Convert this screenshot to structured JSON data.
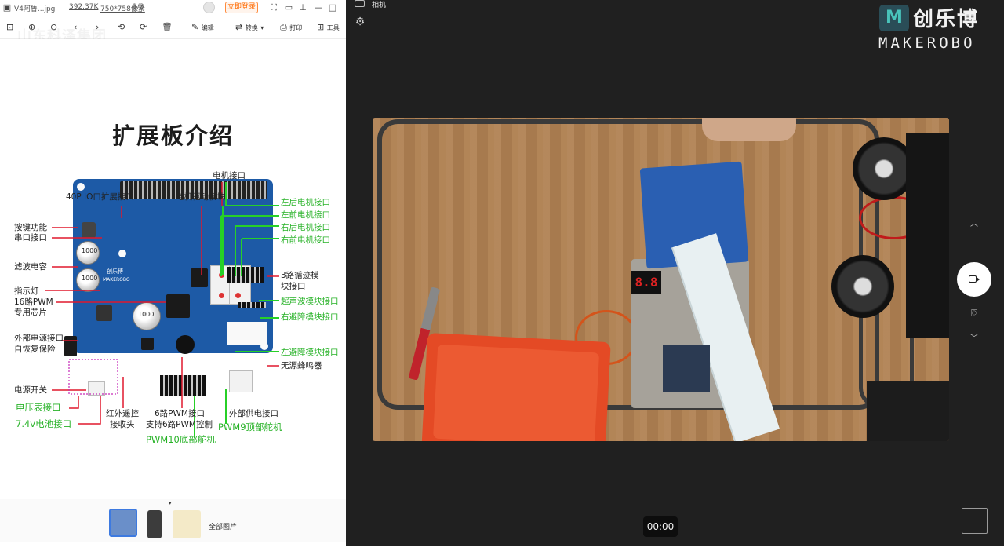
{
  "viewer": {
    "file_name": "V4阿鲁...jpg",
    "file_size": "392.37K",
    "dimensions": "750*758像素",
    "page_index": "1/3",
    "login_label": "立即登录",
    "toolbar": {
      "edit_label": "编辑",
      "convert_label": "转换",
      "print_label": "打印",
      "tools_label": "工具"
    },
    "watermark": "山东科泽集团",
    "thumbnails_label": "全部图片"
  },
  "slide": {
    "title": "扩展板介绍",
    "labels": {
      "motor_port": "电机接口",
      "io_header": "40P IO口扩展接口",
      "motor_driver": "电机驱动模块",
      "left_rear_motor": "左后电机接口",
      "left_front_motor": "左前电机接口",
      "right_rear_motor": "右后电机接口",
      "right_front_motor": "右前电机接口",
      "key_function": "按键功能",
      "serial_port": "串口接口",
      "filter_cap": "滤波电容",
      "indicator": "指示灯",
      "pwm16_a": "16路PWM",
      "pwm16_b": "专用芯片",
      "line_track_a": "3路循迹模",
      "line_track_b": "块接口",
      "ultrasonic": "超声波模块接口",
      "right_obstacle": "右避障模块接口",
      "ext_power_a": "外部电源接口",
      "ext_power_b": "自恢复保险",
      "left_obstacle": "左避障模块接口",
      "buzzer": "无源蜂鸣器",
      "power_switch": "电源开关",
      "voltmeter": "电压表接口",
      "battery": "7.4v电池接口",
      "ir_a": "红外遥控",
      "ir_b": "接收头",
      "pwm6_a": "6路PWM接口",
      "pwm6_b": "支持6路PWM控制",
      "ext_supply": "外部供电接口",
      "pwm9": "PWM9顶部舵机",
      "pwm10": "PWM10底部舵机",
      "board_brand": "创乐博",
      "board_brand_en": "MAKEROBO",
      "switch_mark": "开",
      "cap1": "1000",
      "cap2": "1000",
      "cap3": "1000"
    }
  },
  "camera": {
    "title": "相机",
    "logo_cn": "创乐博",
    "logo_en": "MAKEROBO",
    "logo_mark": "M",
    "segment_display": "8.8",
    "timer": "00:00"
  },
  "colors": {
    "accent_green": "#27b227",
    "pointer_red": "#e0182d",
    "board_blue": "#1d5aa6",
    "login_orange": "#ff6a00",
    "camera_bg": "#202020"
  },
  "icons": {
    "gear": "gear-icon",
    "record": "video-record-icon",
    "snapshot": "camera-icon",
    "chevron_up": "chevron-up-icon",
    "chevron_down": "chevron-down-icon"
  }
}
